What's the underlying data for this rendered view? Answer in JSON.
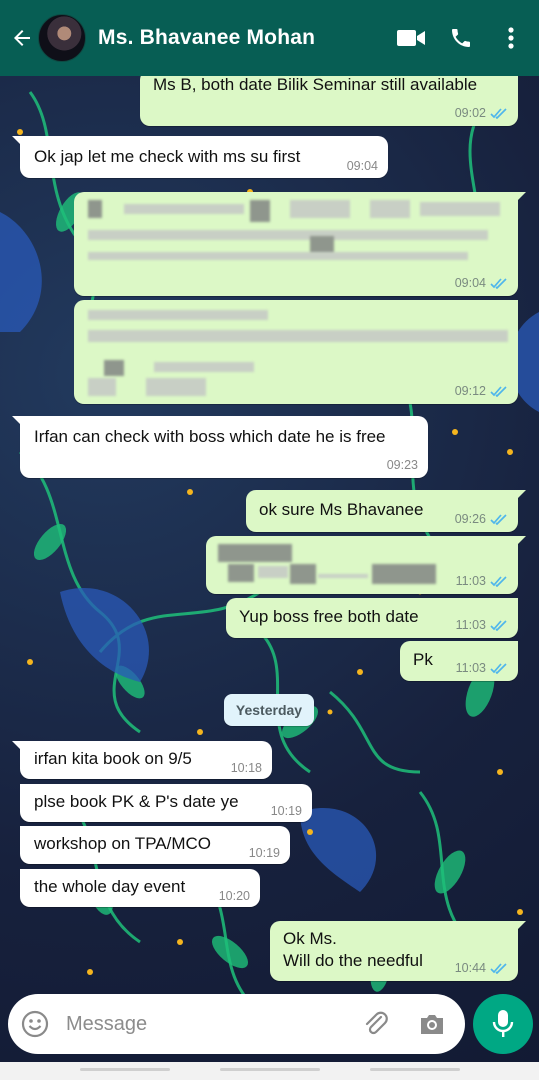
{
  "header": {
    "contact_name": "Ms. Bhavanee Mohan",
    "icons": [
      "back-arrow-icon",
      "video-call-icon",
      "phone-icon",
      "more-options-icon"
    ]
  },
  "messages": [
    {
      "dir": "out",
      "text": "Ms B, both date Bilik Seminar still available",
      "time": "09:02",
      "status": "read"
    },
    {
      "dir": "in",
      "text": "Ok jap let me check with ms su first",
      "time": "09:04"
    },
    {
      "dir": "out",
      "text": "",
      "time": "09:04",
      "status": "read",
      "redacted": true
    },
    {
      "dir": "out",
      "text": "",
      "time": "09:12",
      "status": "read",
      "redacted": true
    },
    {
      "dir": "in",
      "text": "Irfan can check with boss which date he is free",
      "time": "09:23"
    },
    {
      "dir": "out",
      "text": "ok sure Ms Bhavanee",
      "time": "09:26",
      "status": "read"
    },
    {
      "dir": "out",
      "text": "",
      "time": "11:03",
      "status": "read",
      "redacted": true
    },
    {
      "dir": "out",
      "text": "Yup boss free both date",
      "time": "11:03",
      "status": "read"
    },
    {
      "dir": "out",
      "text": "Pk",
      "time": "11:03",
      "status": "read"
    },
    {
      "dir": "in",
      "text": "irfan kita book on 9/5",
      "time": "10:18"
    },
    {
      "dir": "in",
      "text": "plse book PK & P's date ye",
      "time": "10:19"
    },
    {
      "dir": "in",
      "text": "workshop on TPA/MCO",
      "time": "10:19"
    },
    {
      "dir": "in",
      "text": "the whole day event",
      "time": "10:20"
    },
    {
      "dir": "out",
      "text_line1": "Ok Ms.",
      "text_line2": "Will do the needful",
      "time": "10:44",
      "status": "read"
    }
  ],
  "date_separator": "Yesterday",
  "composer": {
    "placeholder": "Message",
    "icons": [
      "emoji-icon",
      "attach-icon",
      "camera-icon",
      "mic-icon"
    ]
  },
  "colors": {
    "header_bg": "#075e54",
    "outgoing_bubble": "#dcf8c6",
    "incoming_bubble": "#ffffff",
    "read_ticks": "#4fb6ec",
    "mic_button": "#00a884"
  }
}
